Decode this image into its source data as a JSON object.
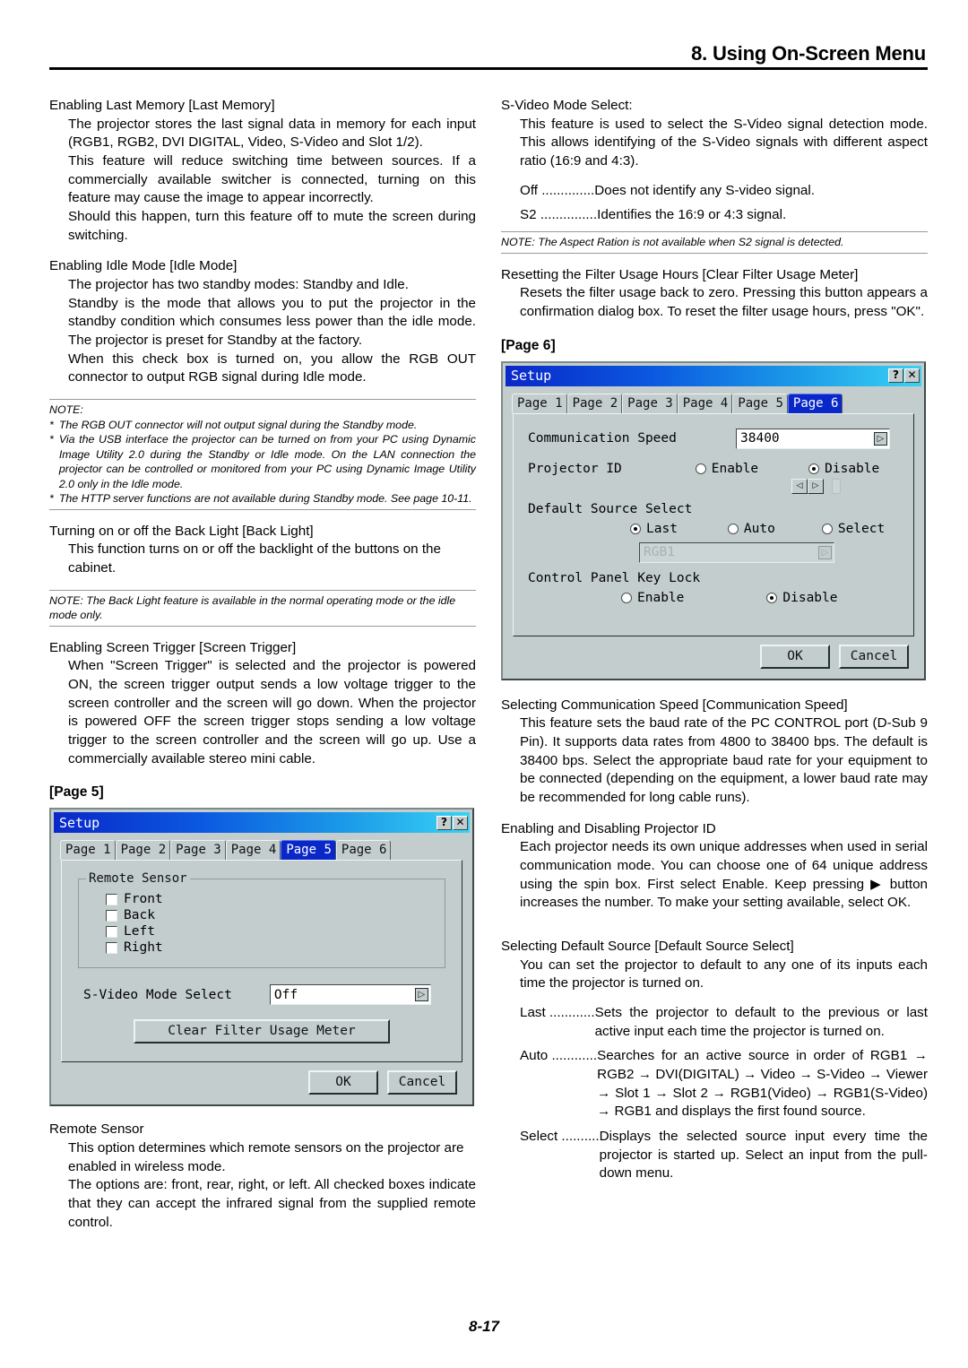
{
  "header": {
    "chapter_title": "8. Using On-Screen Menu"
  },
  "page_number": "8-17",
  "left_column": {
    "sections": [
      {
        "heading": "Enabling Last Memory [Last Memory]",
        "paragraphs": [
          "The projector stores the last signal data in memory for each input (RGB1, RGB2, DVI DIGITAL, Video, S-Video and Slot 1/2).",
          "This feature will reduce switching time between sources. If a commercially available switcher is connected, turning on this feature may cause the image to appear incorrectly.",
          "Should this happen, turn this feature off to mute the screen during switching."
        ]
      },
      {
        "heading": "Enabling Idle Mode [Idle Mode]",
        "paragraphs": [
          "The projector has two standby modes: Standby and Idle.",
          "Standby is the mode that allows you to put the projector in the standby condition which consumes less power than the idle mode. The projector is preset for Standby at the factory.",
          "When this check box is turned on, you allow the RGB OUT connector to output RGB signal during Idle mode."
        ]
      }
    ],
    "note_idle": {
      "label": "NOTE:",
      "bullets": [
        "The RGB OUT connector will not output signal during the Standby mode.",
        "Via the USB interface the projector can be turned on from your PC using Dynamic Image Utility 2.0 during the Standby or Idle mode. On the LAN connection the projector can be controlled or monitored from your PC using Dynamic Image Utility 2.0 only in the Idle mode.",
        "The HTTP server functions are not available during Standby mode. See page 10-11."
      ]
    },
    "section_backlight": {
      "heading": "Turning on or off the Back Light [Back Light]",
      "paragraphs": [
        "This function turns on or off the backlight of the buttons on the cabinet."
      ]
    },
    "note_backlight": "NOTE: The Back Light feature is available in the normal operating mode or the idle mode only.",
    "section_screen_trigger": {
      "heading": "Enabling Screen Trigger [Screen Trigger]",
      "paragraphs": [
        "When \"Screen Trigger\" is selected and the projector is powered ON, the screen trigger output sends a low voltage trigger to the screen controller and the screen will go down. When the projector is powered OFF the screen trigger stops sending a low voltage trigger to the screen controller and the screen will go up. Use a commercially available stereo mini cable."
      ]
    },
    "page5_label": "[Page 5]",
    "section_remote_sensor": {
      "heading": "Remote Sensor",
      "paragraphs": [
        "This option determines which remote sensors on the projector are enabled in wireless mode.",
        "The options are: front, rear, right, or left. All checked boxes indicate that they can accept the infrared signal from the supplied remote control."
      ]
    }
  },
  "right_column": {
    "section_svideo": {
      "heading": "S-Video Mode Select:",
      "paragraphs": [
        "This feature is used to select the S-Video signal detection mode. This allows identifying of the S-Video signals with different aspect ratio (16:9 and 4:3)."
      ],
      "definitions": [
        {
          "term": "Off ..............",
          "desc": "Does not identify any S-video signal."
        },
        {
          "term": "S2 ...............",
          "desc": "Identifies the 16:9 or 4:3 signal."
        }
      ]
    },
    "note_svideo": "NOTE: The Aspect Ration is not available when S2 signal is detected.",
    "section_filter": {
      "heading": "Resetting the Filter Usage Hours [Clear Filter Usage Meter]",
      "paragraphs": [
        "Resets the filter usage back to zero. Pressing this button appears a confirmation dialog box. To reset the filter usage hours, press \"OK\"."
      ]
    },
    "page6_label": "[Page 6]",
    "section_comm_speed": {
      "heading": "Selecting Communication Speed [Communication Speed]",
      "paragraphs": [
        "This feature sets the baud rate of the PC CONTROL port (D-Sub 9 Pin). It supports data rates from 4800 to 38400 bps. The default is 38400 bps. Select the appropriate baud rate for your equipment to be connected (depending on the equipment, a lower baud rate may be recommended for long cable runs)."
      ]
    },
    "section_projector_id": {
      "heading": "Enabling and Disabling Projector ID",
      "paragraphs": [
        "Each projector needs its own unique addresses when used in serial communication mode. You can choose one of 64 unique address using the spin box. First select Enable. Keep pressing ▶ button increases the number. To make your setting available, select OK."
      ]
    },
    "section_default_source": {
      "heading": "Selecting Default Source [Default Source Select]",
      "paragraphs": [
        "You can set the projector to default to any one of its inputs each time the projector is turned on."
      ],
      "definitions": [
        {
          "term": "Last ............",
          "desc": "Sets the projector to default to the previous or last active input each time the projector is turned on."
        },
        {
          "term": "Auto ............",
          "desc": "Searches for an active source in order of RGB1 → RGB2 → DVI(DIGITAL) → Video → S-Video → Viewer → Slot 1 → Slot 2 → RGB1(Video) → RGB1(S-Video) → RGB1 and displays the first found source."
        },
        {
          "term": "Select ..........",
          "desc": "Displays the selected source input every time the projector is started up. Select an input from the pull-down menu."
        }
      ]
    }
  },
  "dialog_page5": {
    "title": "Setup",
    "titlebar_buttons": [
      "?",
      "✕"
    ],
    "tabs": [
      {
        "label": "Page 1",
        "selected": false
      },
      {
        "label": "Page 2",
        "selected": false
      },
      {
        "label": "Page 3",
        "selected": false
      },
      {
        "label": "Page 4",
        "selected": false
      },
      {
        "label": "Page 5",
        "selected": true
      },
      {
        "label": "Page 6",
        "selected": false
      }
    ],
    "groupbox_title": "Remote Sensor",
    "checkboxes": [
      {
        "label": "Front",
        "checked": false
      },
      {
        "label": "Back",
        "checked": false
      },
      {
        "label": "Left",
        "checked": false
      },
      {
        "label": "Right",
        "checked": false
      }
    ],
    "svideo_label": "S-Video Mode Select",
    "svideo_value": "Off",
    "clear_filter_button": "Clear Filter Usage Meter",
    "ok_button": "OK",
    "cancel_button": "Cancel"
  },
  "dialog_page6": {
    "title": "Setup",
    "titlebar_buttons": [
      "?",
      "✕"
    ],
    "tabs": [
      {
        "label": "Page 1",
        "selected": false
      },
      {
        "label": "Page 2",
        "selected": false
      },
      {
        "label": "Page 3",
        "selected": false
      },
      {
        "label": "Page 4",
        "selected": false
      },
      {
        "label": "Page 5",
        "selected": false
      },
      {
        "label": "Page 6",
        "selected": true
      }
    ],
    "comm_speed_label": "Communication Speed",
    "comm_speed_value": "38400",
    "projector_id_label": "Projector ID",
    "projector_id_enable": "Enable",
    "projector_id_disable": "Disable",
    "spin_left": "◁",
    "spin_right": "▷",
    "spin_value": "",
    "default_source_label": "Default Source Select",
    "default_source_options": [
      "Last",
      "Auto",
      "Select"
    ],
    "default_source_selected": "Last",
    "source_combo_value": "RGB1",
    "key_lock_label": "Control Panel Key Lock",
    "key_lock_enable": "Enable",
    "key_lock_disable": "Disable",
    "ok_button": "OK",
    "cancel_button": "Cancel"
  },
  "colors": {
    "dialog_face": "#c3cdcd",
    "titlebar_from": "#0a28c8",
    "titlebar_to": "#39d2f5",
    "tab_selected_bg": "#0a28c8",
    "rule": "#000000"
  }
}
